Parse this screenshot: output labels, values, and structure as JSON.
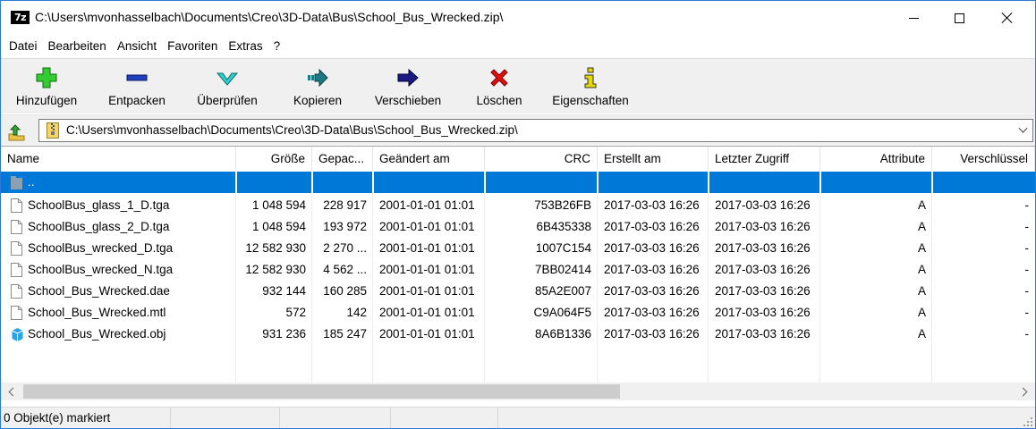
{
  "window": {
    "app_badge": "7z",
    "title": "C:\\Users\\mvonhasselbach\\Documents\\Creo\\3D-Data\\Bus\\School_Bus_Wrecked.zip\\"
  },
  "menu": [
    "Datei",
    "Bearbeiten",
    "Ansicht",
    "Favoriten",
    "Extras",
    "?"
  ],
  "toolbar": {
    "add": "Hinzufügen",
    "extract": "Entpacken",
    "test": "Überprüfen",
    "copy": "Kopieren",
    "move": "Verschieben",
    "delete": "Löschen",
    "info": "Eigenschaften"
  },
  "toolbar_colors": {
    "add": "#33cc33",
    "extract": "#1f3fbf",
    "test": "#33cccc",
    "copy": "#1c7a86",
    "move": "#1a1a80",
    "delete": "#e01010",
    "info": "#e6d800"
  },
  "address": {
    "path": "C:\\Users\\mvonhasselbach\\Documents\\Creo\\3D-Data\\Bus\\School_Bus_Wrecked.zip\\"
  },
  "columns": [
    "Name",
    "Größe",
    "Gepac...",
    "Geändert am",
    "CRC",
    "Erstellt am",
    "Letzter Zugriff",
    "Attribute",
    "Verschlüssel"
  ],
  "parent_row": {
    "name": ".."
  },
  "files": [
    {
      "icon": "tga-file-icon",
      "name": "SchoolBus_glass_1_D.tga",
      "size": "1 048 594",
      "packed": "228 917",
      "modified": "2001-01-01 01:01",
      "crc": "753B26FB",
      "created": "2017-03-03 16:26",
      "accessed": "2017-03-03 16:26",
      "attr": "A",
      "enc": "-"
    },
    {
      "icon": "tga-file-icon",
      "name": "SchoolBus_glass_2_D.tga",
      "size": "1 048 594",
      "packed": "193 972",
      "modified": "2001-01-01 01:01",
      "crc": "6B435338",
      "created": "2017-03-03 16:26",
      "accessed": "2017-03-03 16:26",
      "attr": "A",
      "enc": "-"
    },
    {
      "icon": "tga-file-icon",
      "name": "SchoolBus_wrecked_D.tga",
      "size": "12 582 930",
      "packed": "2 270 ...",
      "modified": "2001-01-01 01:01",
      "crc": "1007C154",
      "created": "2017-03-03 16:26",
      "accessed": "2017-03-03 16:26",
      "attr": "A",
      "enc": "-"
    },
    {
      "icon": "tga-file-icon",
      "name": "SchoolBus_wrecked_N.tga",
      "size": "12 582 930",
      "packed": "4 562 ...",
      "modified": "2001-01-01 01:01",
      "crc": "7BB02414",
      "created": "2017-03-03 16:26",
      "accessed": "2017-03-03 16:26",
      "attr": "A",
      "enc": "-"
    },
    {
      "icon": "dae-file-icon",
      "name": "School_Bus_Wrecked.dae",
      "size": "932 144",
      "packed": "160 285",
      "modified": "2001-01-01 01:01",
      "crc": "85A2E007",
      "created": "2017-03-03 16:26",
      "accessed": "2017-03-03 16:26",
      "attr": "A",
      "enc": "-"
    },
    {
      "icon": "mtl-file-icon",
      "name": "School_Bus_Wrecked.mtl",
      "size": "572",
      "packed": "142",
      "modified": "2001-01-01 01:01",
      "crc": "C9A064F5",
      "created": "2017-03-03 16:26",
      "accessed": "2017-03-03 16:26",
      "attr": "A",
      "enc": "-"
    },
    {
      "icon": "obj-3d-file-icon",
      "name": "School_Bus_Wrecked.obj",
      "size": "931 236",
      "packed": "185 247",
      "modified": "2001-01-01 01:01",
      "crc": "8A6B1336",
      "created": "2017-03-03 16:26",
      "accessed": "2017-03-03 16:26",
      "attr": "A",
      "enc": "-"
    }
  ],
  "status": {
    "selection": "0 Objekt(e) markiert"
  }
}
